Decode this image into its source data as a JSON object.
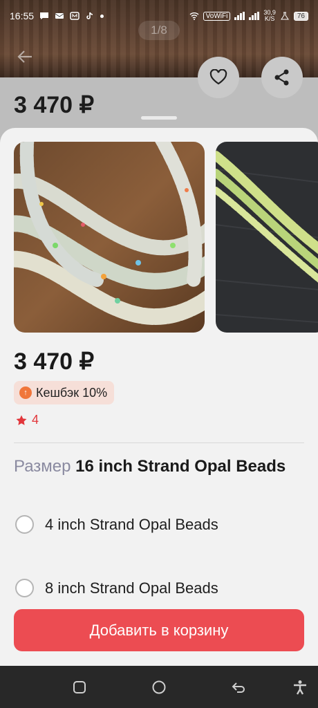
{
  "status_bar": {
    "time": "16:55",
    "network": "VoWiFi",
    "speed": "30,9",
    "speed_unit": "K/S",
    "battery": "76"
  },
  "gallery_counter": "1/8",
  "background": {
    "price": "3 470 ₽"
  },
  "sheet": {
    "price": "3 470 ₽",
    "cashback": "Кешбэк 10%",
    "rating": "4",
    "size_label": "Размер",
    "size_selected": "16 inch Strand Opal Beads",
    "options": [
      {
        "label": "4 inch Strand Opal Beads",
        "selected": false
      },
      {
        "label": "8 inch Strand Opal Beads",
        "selected": false
      }
    ],
    "add_to_cart": "Добавить в корзину"
  },
  "colors": {
    "accent": "#ec4c52",
    "star": "#e2363b",
    "cashback_bg": "#f6dfd8"
  },
  "icons": [
    "back-arrow-icon",
    "heart-icon",
    "share-icon",
    "star-icon",
    "cashback-icon",
    "square-nav-icon",
    "home-nav-icon",
    "back-nav-icon",
    "accessibility-icon"
  ]
}
